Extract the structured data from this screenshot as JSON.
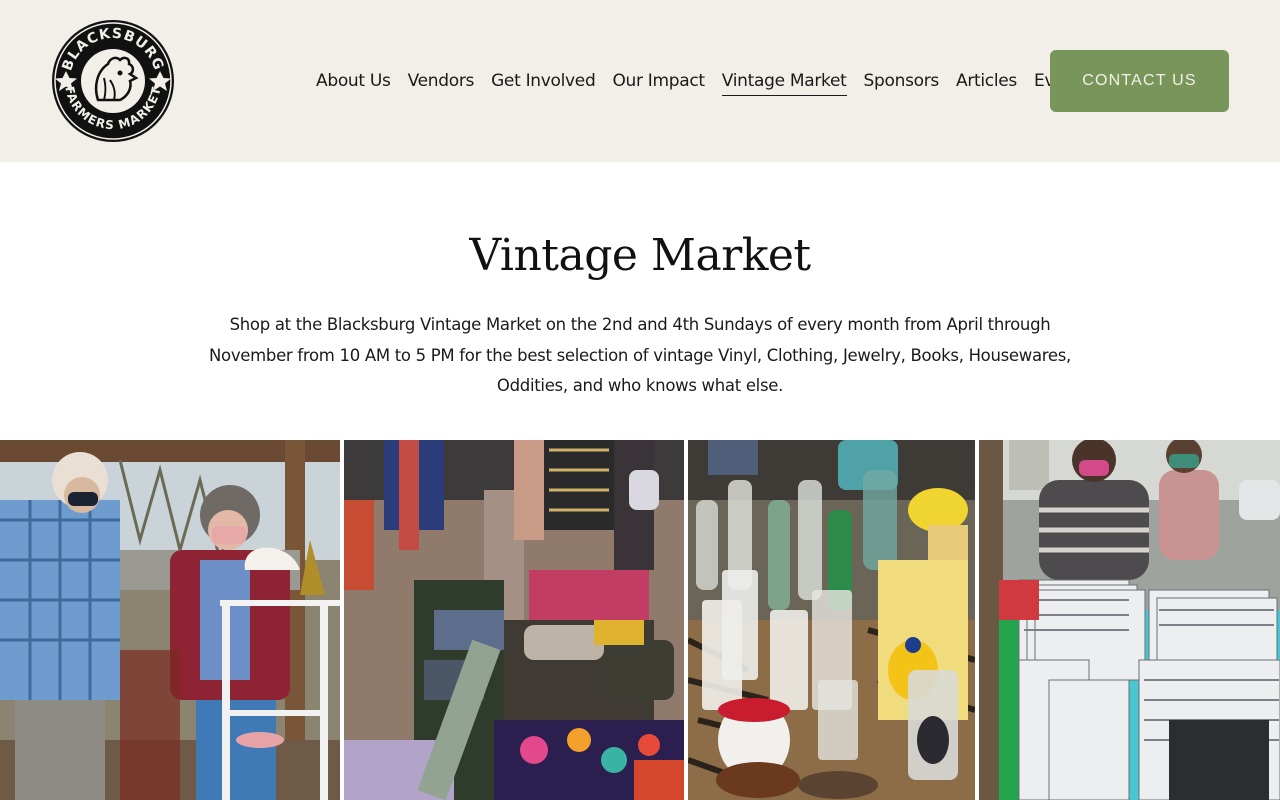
{
  "logo": {
    "icon": "rooster-seal-logo",
    "text_top": "BLACKSBURG",
    "text_bottom": "FARMERS MARKET"
  },
  "nav": {
    "items": [
      {
        "label": "About Us"
      },
      {
        "label": "Vendors"
      },
      {
        "label": "Get Involved"
      },
      {
        "label": "Our Impact"
      },
      {
        "label": "Vintage Market",
        "active": true
      },
      {
        "label": "Sponsors"
      },
      {
        "label": "Articles"
      },
      {
        "label": "Events"
      }
    ],
    "cta_label": "CONTACT US"
  },
  "page": {
    "title": "Vintage Market",
    "intro": "Shop at the Blacksburg Vintage Market on the 2nd and 4th Sundays of every month from April through November from 10 AM to 5 PM for the best selection of vintage Vinyl, Clothing, Jewelry, Books, Housewares, Oddities, and who knows what else."
  },
  "colors": {
    "header_bg": "#f1efe8",
    "accent": "#789659",
    "cta_text": "#f3f1e9",
    "text": "#1a1a1a"
  },
  "gallery": {
    "photos": [
      {
        "name": "shoppers-browsing-photo"
      },
      {
        "name": "clothing-and-suitcases-photo"
      },
      {
        "name": "glassware-photo"
      },
      {
        "name": "vinyl-records-photo"
      }
    ]
  }
}
